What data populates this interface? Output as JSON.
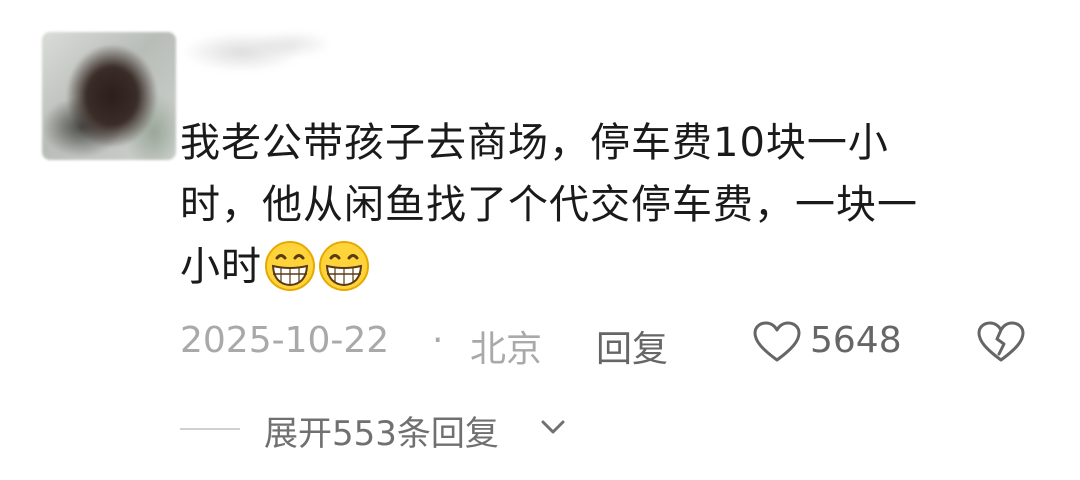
{
  "comment": {
    "text_line1": "我老公带孩子去商场，停车费10块一小",
    "text_line2": "时，他从闲鱼找了个代交停车费，一块一",
    "text_line3": "小时",
    "emojis": [
      "grinning-face-icon",
      "grinning-face-icon"
    ],
    "date": "2025-10-22",
    "separator": "·",
    "location": "北京",
    "reply_label": "回复",
    "like_count": "5648",
    "expand_label": "展开553条回复"
  },
  "colors": {
    "text": "#1a1a1a",
    "meta": "#a9a9a9",
    "action": "#666666"
  }
}
